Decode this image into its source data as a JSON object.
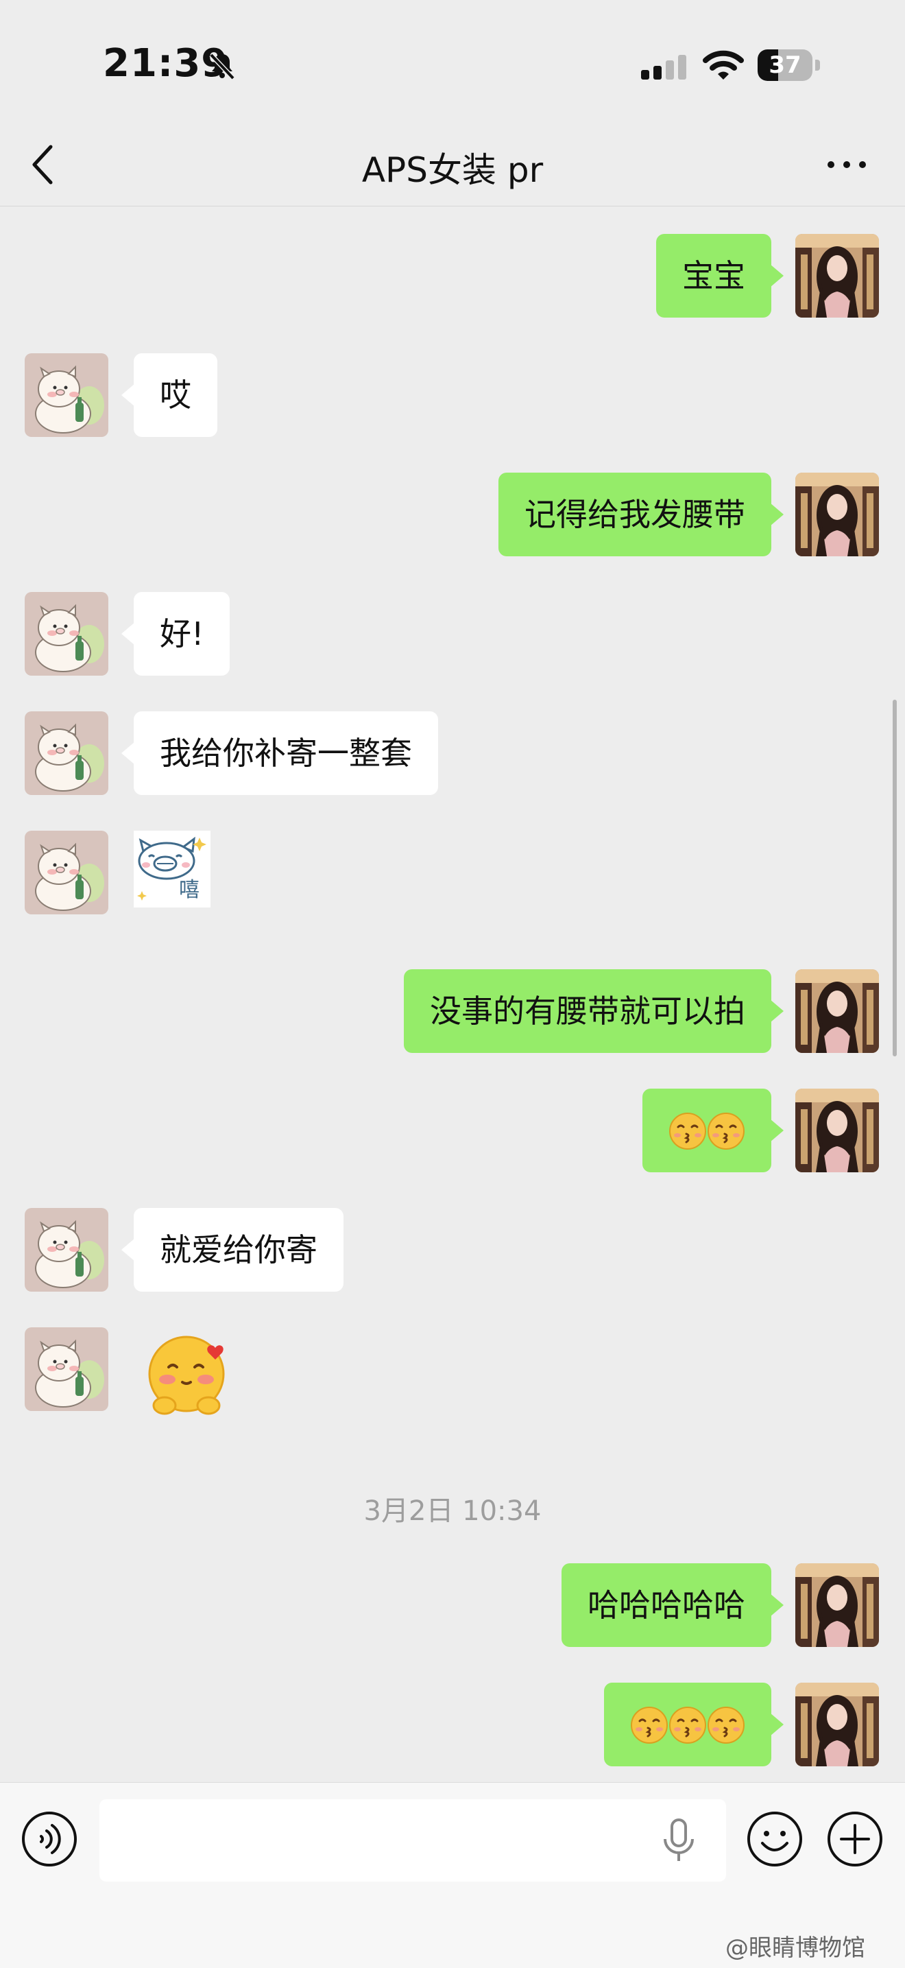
{
  "status": {
    "time": "21:39",
    "battery": "37",
    "battery_level": 0.37
  },
  "nav": {
    "title": "APS女装 pr"
  },
  "messages": [
    {
      "side": "self",
      "text": "宝宝"
    },
    {
      "side": "peer",
      "text": "哎"
    },
    {
      "side": "self",
      "text": "记得给我发腰带"
    },
    {
      "side": "peer",
      "text": "好!"
    },
    {
      "side": "peer",
      "text": "我给你补寄一整套"
    },
    {
      "side": "peer",
      "sticker": "pig-xi-sticker",
      "sticker_text": "嘻"
    },
    {
      "side": "self",
      "text": "没事的有腰带就可以拍"
    },
    {
      "side": "self",
      "emoji_count": 2,
      "emoji": "kissing-face-emoji"
    },
    {
      "side": "peer",
      "text": "就爱给你寄"
    },
    {
      "side": "peer",
      "sticker": "blush-kiss-emoji-sticker"
    },
    {
      "side": "self",
      "text": "哈哈哈哈哈"
    },
    {
      "side": "self",
      "emoji_count": 3,
      "emoji": "kissing-face-emoji"
    }
  ],
  "timestamp": "3月2日 10:34",
  "colors": {
    "self_bubble": "#95ec69",
    "peer_bubble": "#ffffff",
    "background": "#ededed"
  },
  "watermark": "@眼睛博物馆"
}
